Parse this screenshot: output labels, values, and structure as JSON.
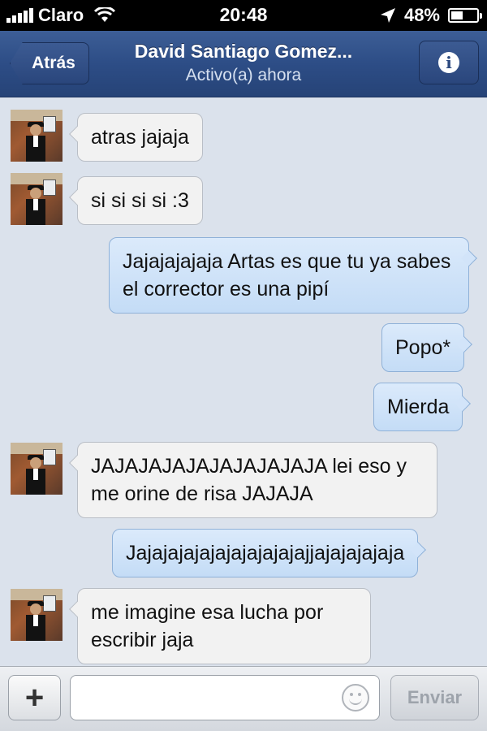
{
  "status_bar": {
    "carrier": "Claro",
    "time": "20:48",
    "battery_text": "48%",
    "battery_level": 0.48,
    "icons": [
      "signal-bars-icon",
      "wifi-icon",
      "location-arrow-icon",
      "battery-icon"
    ]
  },
  "nav": {
    "back_label": "Atrás",
    "title": "David Santiago Gomez...",
    "subtitle": "Activo(a) ahora",
    "info_icon": "info-icon",
    "info_glyph": "i"
  },
  "messages": [
    {
      "from": "contact",
      "text": "atras jajaja"
    },
    {
      "from": "contact",
      "text": "si si si si :3"
    },
    {
      "from": "me",
      "text": "Jajajajajaja Artas es que tu ya sabes el corrector es una pipí"
    },
    {
      "from": "me",
      "text": "Popo*"
    },
    {
      "from": "me",
      "text": "Mierda"
    },
    {
      "from": "contact",
      "text": "JAJAJAJAJAJAJAJAJAJA lei eso y me orine de risa JAJAJA"
    },
    {
      "from": "me",
      "text": "Jajajajajajajajajajajajjajajajajaja"
    },
    {
      "from": "contact",
      "text": "me imagine esa lucha por escribir jaja"
    }
  ],
  "composer": {
    "plus_label": "+",
    "input_value": "",
    "input_placeholder": "",
    "emoji_icon": "smiley-icon",
    "send_label": "Enviar"
  },
  "colors": {
    "nav_bar": "#2d4d86",
    "background": "#dbe2ec",
    "incoming_bubble": "#f2f2f2",
    "outgoing_bubble": "#c4dcf6"
  }
}
